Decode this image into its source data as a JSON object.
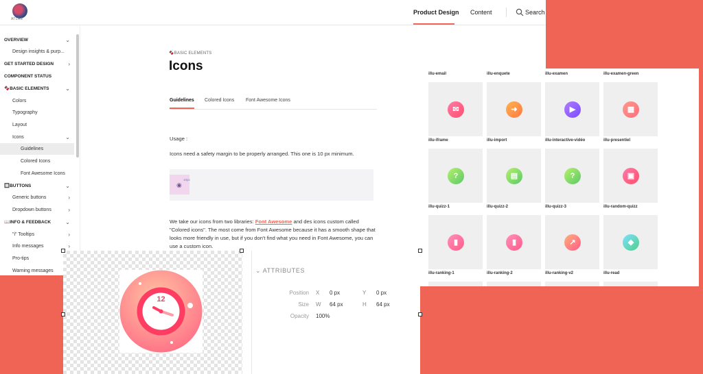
{
  "header": {
    "logo_text": "ATLAS",
    "nav": {
      "product_design": "Product Design",
      "content": "Content",
      "search": "Search"
    }
  },
  "sidebar": {
    "items": [
      {
        "label": "OVERVIEW",
        "section": true,
        "chevron": "⌄"
      },
      {
        "label": "Design insights & purp...",
        "section": false,
        "chevron": ""
      },
      {
        "label": "GET STARTED DESIGN",
        "section": true,
        "chevron": "›"
      },
      {
        "label": "COMPONENT STATUS",
        "section": true,
        "chevron": ""
      },
      {
        "label": "🍫BASIC ELEMENTS",
        "section": true,
        "chevron": "⌄"
      },
      {
        "label": "Colors",
        "section": false,
        "chevron": ""
      },
      {
        "label": "Typography",
        "section": false,
        "chevron": ""
      },
      {
        "label": "Layout",
        "section": false,
        "chevron": ""
      },
      {
        "label": "Icons",
        "section": false,
        "chevron": "⌄"
      },
      {
        "label": "Guidelines",
        "section": false,
        "chevron": "",
        "active": true
      },
      {
        "label": "Colored Icons",
        "section": false,
        "chevron": ""
      },
      {
        "label": "Font Awesome Icons",
        "section": false,
        "chevron": ""
      },
      {
        "label": "🔲BUTTONS",
        "section": true,
        "chevron": "⌄"
      },
      {
        "label": "Generic buttons",
        "section": false,
        "chevron": "›"
      },
      {
        "label": "Dropdown buttons",
        "section": false,
        "chevron": "›"
      },
      {
        "label": "📖INFO & FEEDBACK",
        "section": true,
        "chevron": "⌄"
      },
      {
        "label": "\"i\" Tooltips",
        "section": false,
        "chevron": "›"
      },
      {
        "label": "Info messages",
        "section": false,
        "chevron": "›"
      },
      {
        "label": "Pro-tips",
        "section": false,
        "chevron": ""
      },
      {
        "label": "Warning messages",
        "section": false,
        "chevron": ""
      }
    ]
  },
  "main": {
    "breadcrumb": "🍫BASIC ELEMENTS",
    "title": "Icons",
    "tabs": [
      "Guidelines",
      "Colored Icons",
      "Font Awesome Icons"
    ],
    "usage": "Usage :",
    "safety": "Icons need a safety margin to be properly arranged. This one is 10 px minimum.",
    "demo_label": "10px",
    "libs_before": "We take our icons from two libraries: ",
    "libs_link": "Font Awesome",
    "libs_after": " and des icons custom called \"Colored icons\". The most come from Font Awesome because it has a smooth shape that looks more friendly in use, but if you don't find what you need in Font Awesome, you can use a custom icon."
  },
  "icon_grid": {
    "rows": [
      [
        "illu-email",
        "illu-enquete",
        "illu-examen",
        "illu-examen-green"
      ],
      [
        "illu-iframe",
        "illu-import",
        "illu-interactive-vidéo",
        "illu-presentiel"
      ],
      [
        "illu-quizz-1",
        "illu-quizz-2",
        "illu-quizz-3",
        "illu-random-quizz"
      ],
      [
        "illu-ranking-1",
        "illu-ranking-2",
        "illu-ranking-v2",
        "illu-read"
      ]
    ],
    "icons": [
      [
        "email-icon",
        "enquete-icon",
        "examen-icon",
        "examen-green-icon"
      ],
      [
        "iframe-icon",
        "import-icon",
        "interactive-video-icon",
        "presentiel-icon"
      ],
      [
        "quizz-1-icon",
        "quizz-2-icon",
        "quizz-3-icon",
        "random-quizz-icon"
      ]
    ]
  },
  "inspector": {
    "clock_number": "12",
    "heading": "ATTRIBUTES",
    "position_label": "Position",
    "size_label": "Size",
    "opacity_label": "Opacity",
    "x_axis": "X",
    "y_axis": "Y",
    "w_axis": "W",
    "h_axis": "H",
    "x_value": "0 px",
    "y_value": "0 px",
    "w_value": "64 px",
    "h_value": "64 px",
    "opacity_value": "100%"
  },
  "colors": {
    "accent": "#f06455",
    "background": "#f06455"
  }
}
